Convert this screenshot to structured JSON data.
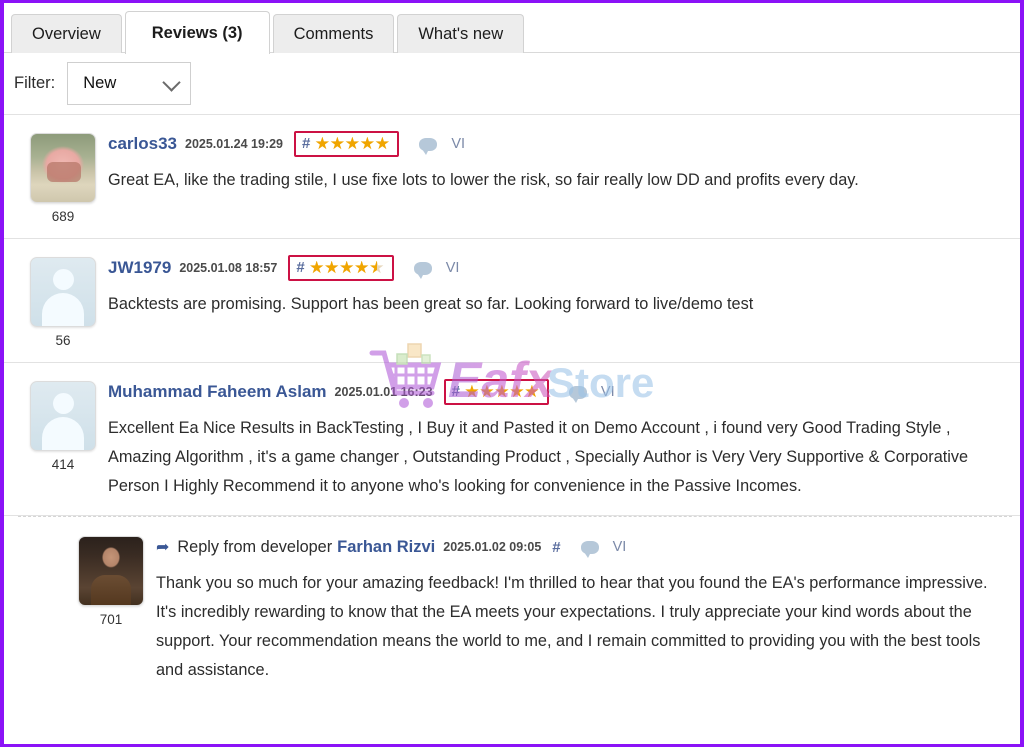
{
  "tabs": [
    {
      "label": "Overview",
      "active": false
    },
    {
      "label": "Reviews (3)",
      "active": true
    },
    {
      "label": "Comments",
      "active": false
    },
    {
      "label": "What's new",
      "active": false
    }
  ],
  "filter": {
    "label": "Filter:",
    "value": "New",
    "icon": "chevron-down-icon"
  },
  "watermark": {
    "text_primary": "Eafx",
    "text_secondary": "Store",
    "icon": "shopping-cart-icon",
    "color_primary": "#b05bd8",
    "color_secondary": "#9cc3e8"
  },
  "colors": {
    "page_border": "#8B12F7",
    "username": "#3a5795",
    "star": "#f0a500",
    "rating_highlight_box": "#cc1144",
    "bubble": "#b6c8d9"
  },
  "reviews": [
    {
      "avatar_kind": "cat-photo",
      "avatar_count": "689",
      "username": "carlos33",
      "timestamp": "2025.01.24 19:29",
      "hash": "#",
      "stars_full": 5,
      "stars_half": 0,
      "comment_icon": "speech-bubble-icon",
      "lang_tag": "VI",
      "text": "Great EA, like the trading stile, I use fixe lots to lower the risk, so fair really low DD and profits every day."
    },
    {
      "avatar_kind": "default-person",
      "avatar_count": "56",
      "username": "JW1979",
      "timestamp": "2025.01.08 18:57",
      "hash": "#",
      "stars_full": 4,
      "stars_half": 1,
      "comment_icon": "speech-bubble-icon",
      "lang_tag": "VI",
      "text": "Backtests are promising. Support has been great so far. Looking forward to live/demo test"
    },
    {
      "avatar_kind": "default-person",
      "avatar_count": "414",
      "username": "Muhammad Faheem Aslam",
      "timestamp": "2025.01.01 16:23",
      "hash": "#",
      "stars_full": 5,
      "stars_half": 0,
      "comment_icon": "speech-bubble-icon",
      "lang_tag": "VI",
      "text": "Excellent Ea Nice Results in BackTesting , I Buy it and Pasted it on Demo Account , i found very Good Trading Style , Amazing Algorithm , it's a game changer , Outstanding Product , Specially Author is Very Very Supportive & Corporative Person I Highly Recommend it to anyone who's looking for convenience in the Passive Incomes."
    }
  ],
  "reply": {
    "avatar_kind": "developer-photo",
    "avatar_count": "701",
    "arrow_icon": "reply-arrow-icon",
    "prefix": "Reply from developer",
    "developer_name": "Farhan Rizvi",
    "timestamp": "2025.01.02 09:05",
    "hash": "#",
    "comment_icon": "speech-bubble-icon",
    "lang_tag": "VI",
    "text": "Thank you so much for your amazing feedback! I'm thrilled to hear that you found the EA's performance impressive. It's incredibly rewarding to know that the EA meets your expectations. I truly appreciate your kind words about the support. Your recommendation means the world to me, and I remain committed to providing you with the best tools and assistance."
  }
}
